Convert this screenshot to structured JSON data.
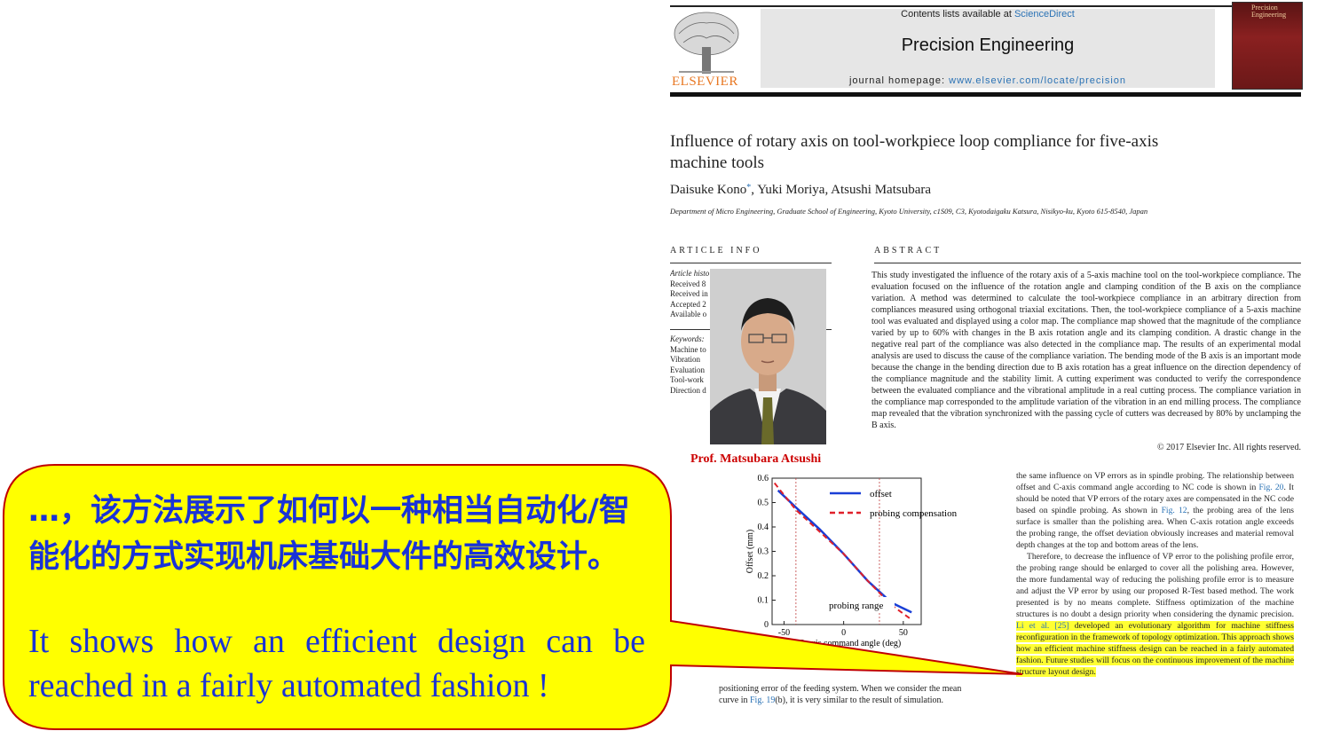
{
  "header": {
    "contents_prefix": "Contents lists available at ",
    "contents_link": "ScienceDirect",
    "journal_title": "Precision Engineering",
    "homepage_prefix": "journal homepage: ",
    "homepage_link": "www.elsevier.com/locate/precision",
    "publisher": "ELSEVIER",
    "cover_text": "Precision Engineering"
  },
  "paper": {
    "title": "Influence of rotary axis on tool-workpiece loop compliance for five-axis machine tools",
    "authors": "Daisuke Kono",
    "authors_star": "*",
    "authors_rest": ", Yuki Moriya, Atsushi Matsubara",
    "affiliation": "Department of Micro Engineering, Graduate School of Engineering, Kyoto University, c1S09, C3, Kyotodaigaku Katsura, Nisikyo-ku, Kyoto 615-8540, Japan",
    "article_info_heading": "ARTICLE INFO",
    "abstract_heading": "ABSTRACT",
    "history_lines": [
      "Article histo",
      "Received 8",
      "Received in",
      "Accepted 2",
      "Available o"
    ],
    "keywords_label": "Keywords:",
    "keywords": [
      "Machine to",
      "Vibration",
      "Evaluation",
      "Tool-work",
      "Direction d"
    ],
    "abstract": "This study investigated the influence of the rotary axis of a 5-axis machine tool on the tool-workpiece compliance. The evaluation focused on the influence of the rotation angle and clamping condition of the B axis on the compliance variation. A method was determined to calculate the tool-workpiece compliance in an arbitrary direction from compliances measured using orthogonal triaxial excitations. Then, the tool-workpiece compliance of a 5-axis machine tool was evaluated and displayed using a color map. The compliance map showed that the magnitude of the compliance varied by up to 60% with changes in the B axis rotation angle and its clamping condition. A drastic change in the negative real part of the compliance was also detected in the compliance map. The results of an experimental modal analysis are used to discuss the cause of the compliance variation. The bending mode of the B axis is an important mode because the change in the bending direction due to B axis rotation has a great influence on the direction dependency of the compliance magnitude and the stability limit. A cutting experiment was conducted to verify the correspondence between the evaluated compliance and the vibrational amplitude in a real cutting process. The compliance variation in the compliance map corresponded to the amplitude variation of the vibration in an end milling process. The compliance map revealed that the vibration synchronized with the passing cycle of cutters was decreased by 80% by unclamping the B axis.",
    "copyright": "© 2017 Elsevier Inc. All rights reserved."
  },
  "photo": {
    "caption": "Prof. Matsubara Atsushi"
  },
  "chart_data": {
    "type": "line",
    "title": "",
    "xlabel": "C-axis command angle (deg)",
    "ylabel": "Offset (mm)",
    "xlim": [
      -60,
      65
    ],
    "ylim": [
      0,
      0.6
    ],
    "x_ticks": [
      "-50",
      "0",
      "50"
    ],
    "y_ticks": [
      "0",
      "0.1",
      "0.2",
      "0.3",
      "0.4",
      "0.5",
      "0.6"
    ],
    "series": [
      {
        "name": "offset",
        "color": "#1a3fd6",
        "style": "solid",
        "x": [
          -55,
          -40,
          -20,
          0,
          20,
          40,
          57
        ],
        "y": [
          0.55,
          0.48,
          0.39,
          0.29,
          0.18,
          0.09,
          0.05
        ]
      },
      {
        "name": "probing compensation",
        "color": "#e0202a",
        "style": "dashed",
        "x": [
          -58,
          -40,
          -20,
          0,
          20,
          40,
          57
        ],
        "y": [
          0.58,
          0.47,
          0.38,
          0.29,
          0.18,
          0.08,
          0.02
        ]
      }
    ],
    "annotation": "probing range",
    "probing_range": [
      -40,
      30
    ]
  },
  "body_text": {
    "below_chart_1": "positioning error of the feeding system. When we consider the mean",
    "below_chart_2a": "curve in ",
    "below_chart_link": "Fig. 19",
    "below_chart_2b": "(b), it is very similar to the result of simulation.",
    "right_p1a": "the same influence on VP errors as in spindle probing. The relationship between offset and C-axis command angle according to NC code is shown in ",
    "right_p1_link1": "Fig. 20",
    "right_p1b": ". It should be noted that VP errors of the rotary axes are compensated in the NC code based on spindle probing. As shown in ",
    "right_p1_link2": "Fig. 12",
    "right_p1c": ", the probing area of the lens surface is smaller than the polishing area. When C-axis rotation angle exceeds the probing range, the offset deviation obviously increases and material removal depth changes at the top and bottom areas of the lens.",
    "right_p2a": "Therefore, to decrease the influence of VP error to the polishing profile error, the probing range should be enlarged to cover all the polishing area. However, the more fundamental way of reducing the polishing profile error is to measure and adjust the VP error by using our proposed R-Test based method. The work presented is by no means complete. Stiffness optimization of the machine structures is no doubt a design priority when considering the dynamic precision. ",
    "right_p2_hl_link": "Li et al. [25]",
    "right_p2_hl": " developed an evolutionary algorithm for machine stiffness reconfiguration in the framework of topology optimization. This approach shows how an efficient machine stiffness design can be reached in a fairly automated fashion. Future studies will focus on the continuous improvement of the machine structure layout design."
  },
  "callout": {
    "chinese": "…，该方法展示了如何以一种相当自动化/智能化的方式实现机床基础大件的高效设计。",
    "english_line1": "It shows how an efficient design can be",
    "english_line2": "reached in a fairly automated fashion !",
    "fill_color": "#ffff00",
    "border_color": "#c00000",
    "text_color": "#1a33d6"
  }
}
